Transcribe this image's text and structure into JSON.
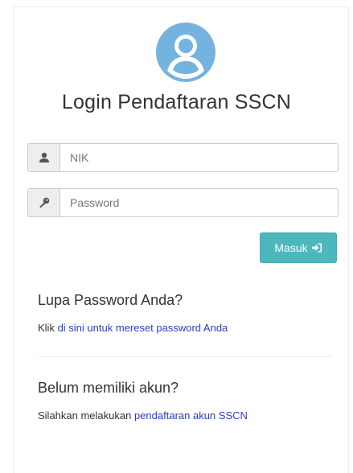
{
  "login": {
    "title": "Login Pendaftaran SSCN",
    "nik_placeholder": "NIK",
    "password_placeholder": "Password",
    "submit_label": "Masuk"
  },
  "forgot": {
    "heading": "Lupa Password Anda?",
    "prefix": "Klik ",
    "link_text": "di sini untuk mereset password Anda"
  },
  "register": {
    "heading": "Belum memiliki akun?",
    "prefix": "Silahkan melakukan ",
    "link_text": "pendaftaran akun SSCN"
  },
  "icons": {
    "avatar": "user-avatar-icon",
    "nik": "user-icon",
    "password": "key-icon",
    "submit": "sign-in-icon"
  },
  "colors": {
    "avatar": "#75b3df",
    "button": "#4cb7bd",
    "link": "#2a3ec2",
    "addon_bg": "#eeeeee"
  }
}
